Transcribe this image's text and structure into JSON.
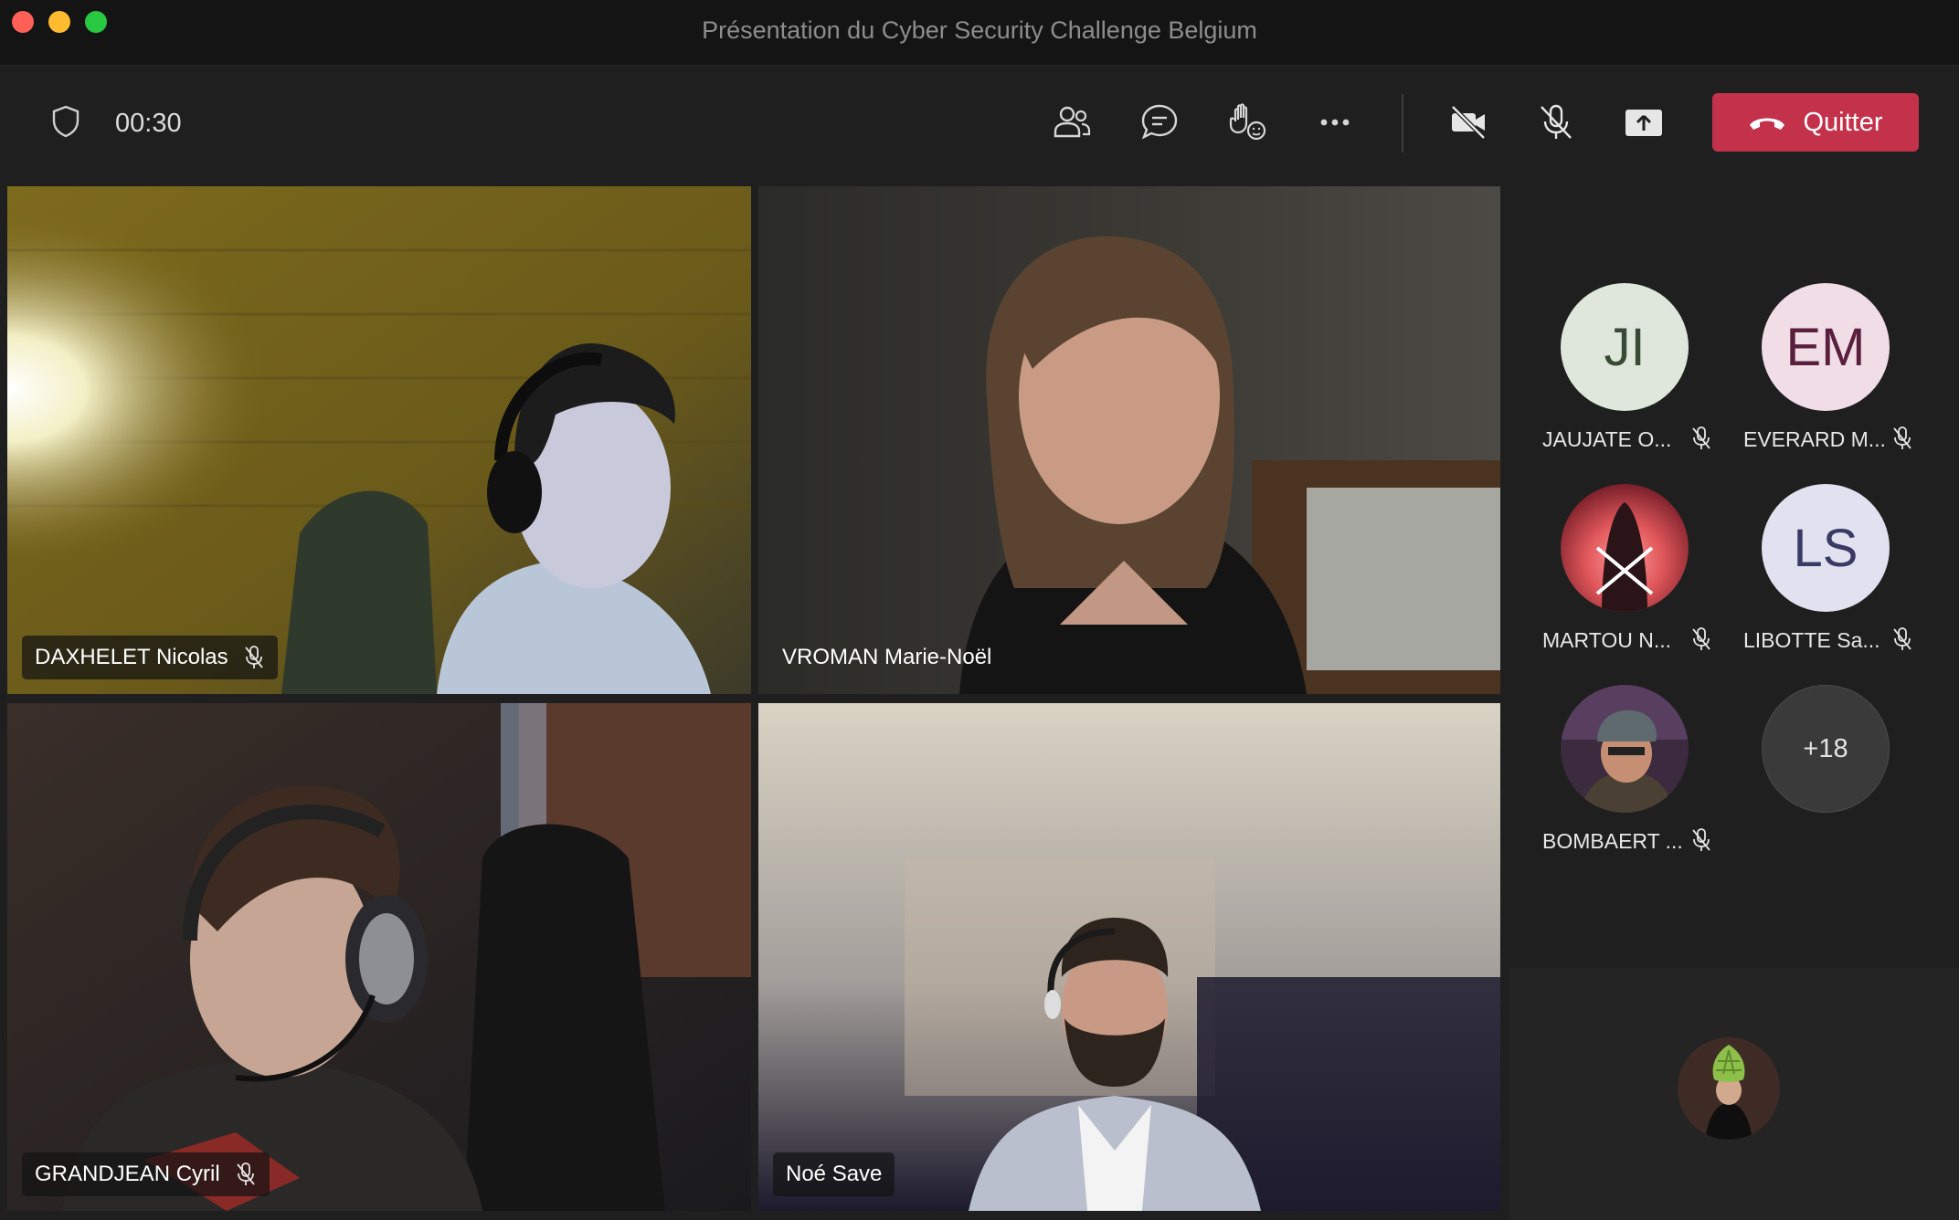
{
  "window": {
    "title": "Présentation du Cyber Security Challenge Belgium"
  },
  "toolbar": {
    "timer": "00:30",
    "shield_icon": "shield-icon",
    "participants_icon": "people-icon",
    "chat_icon": "chat-icon",
    "reactions_icon": "raise-hand-icon",
    "more_icon": "more-icon",
    "camera_icon": "camera-off-icon",
    "mic_icon": "mic-off-icon",
    "share_icon": "share-screen-icon",
    "leave_label": "Quitter",
    "leave_color": "#c4314b"
  },
  "tiles": [
    {
      "name": "DAXHELET Nicolas",
      "muted": true
    },
    {
      "name": "VROMAN Marie-Noël",
      "muted": false
    },
    {
      "name": "GRANDJEAN Cyril",
      "muted": true
    },
    {
      "name": "Noé Save",
      "muted": false
    }
  ],
  "roster": {
    "people": [
      {
        "initials": "JI",
        "name": "JAUJATE O...",
        "muted": true
      },
      {
        "initials": "EM",
        "name": "EVERARD M...",
        "muted": true
      },
      {
        "initials": "",
        "name": "MARTOU N...",
        "muted": true
      },
      {
        "initials": "LS",
        "name": "LIBOTTE Sa...",
        "muted": true
      },
      {
        "initials": "",
        "name": "BOMBAERT ...",
        "muted": true
      }
    ],
    "overflow": "+18"
  }
}
